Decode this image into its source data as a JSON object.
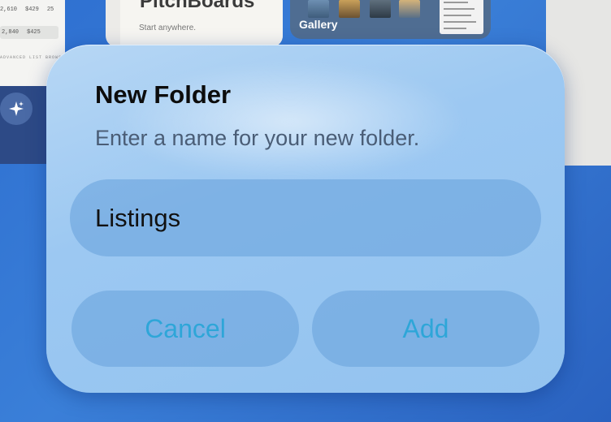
{
  "background": {
    "left_card": {
      "rows": [
        [
          "2,610",
          "$429",
          "25"
        ],
        [
          "2,840",
          "$425",
          ""
        ]
      ],
      "footer": "ADVANCED LIST BROWSE"
    },
    "pitchboards": {
      "title": "PitchBoards",
      "subtitle": "Start anywhere."
    },
    "gallery": {
      "label": "Gallery"
    },
    "sparkle_icon": "sparkle-icon"
  },
  "dialog": {
    "title": "New Folder",
    "message": "Enter a name for your new folder.",
    "name_field": {
      "value": "Listings",
      "placeholder": ""
    },
    "cancel_label": "Cancel",
    "add_label": "Add"
  },
  "colors": {
    "button_text": "#2ea6d8",
    "dialog_bg": "#9cc8f2",
    "desktop_bg": "#2e6fd0"
  }
}
